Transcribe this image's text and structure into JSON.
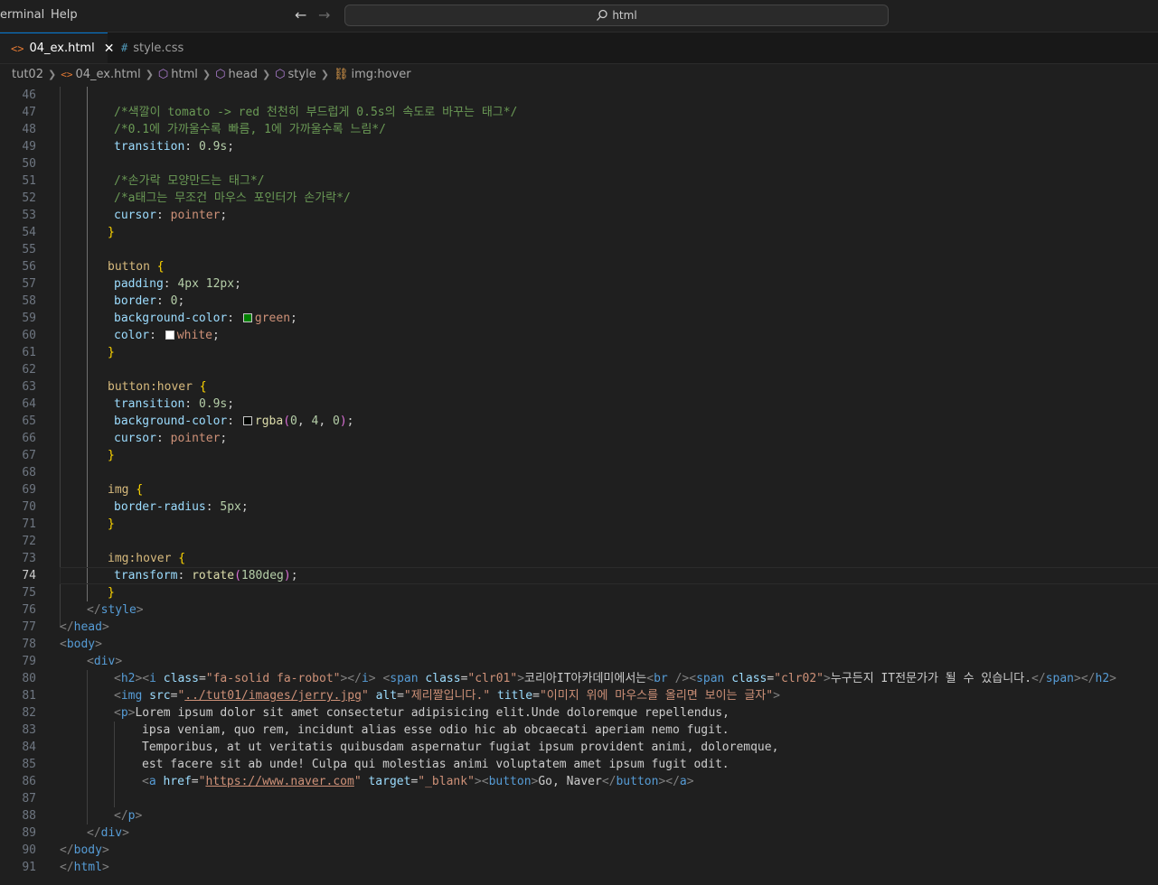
{
  "menu": {
    "terminal": "erminal",
    "help": "Help"
  },
  "search": {
    "text": "html"
  },
  "tabs": [
    {
      "icon": "<>",
      "label": "04_ex.html",
      "close": "✕"
    },
    {
      "icon": "#",
      "label": "style.css"
    }
  ],
  "breadcrumb": [
    "tut02",
    "04_ex.html",
    "html",
    "head",
    "style",
    "img:hover"
  ],
  "colors": {
    "green_swatch": "#008000",
    "white_swatch": "#ffffff",
    "rgba_swatch": "#000400"
  },
  "code": {
    "l46": "46",
    "l47n": "47",
    "l47": "/*색깔이 tomato -> red 천천히 부드럽게 0.5s의 속도로 바꾸는 태그*/",
    "l48n": "48",
    "l48": "/*0.1에 가까울수록 빠름, 1에 가까울수록 느림*/",
    "l49n": "49",
    "l49p": "transition",
    "l49v": "0.9s",
    "l50n": "50",
    "l51n": "51",
    "l51": "/*손가락 모양만드는 태그*/",
    "l52n": "52",
    "l52": "/*a태그는 무조건 마우스 포인터가 손가락*/",
    "l53n": "53",
    "l53p": "cursor",
    "l53v": "pointer",
    "l54n": "54",
    "l55n": "55",
    "l56n": "56",
    "l56s": "button",
    "l57n": "57",
    "l57p": "padding",
    "l57v": "4px 12px",
    "l58n": "58",
    "l58p": "border",
    "l58v": "0",
    "l59n": "59",
    "l59p": "background-color",
    "l59v": "green",
    "l60n": "60",
    "l60p": "color",
    "l60v": "white",
    "l61n": "61",
    "l62n": "62",
    "l63n": "63",
    "l63s": "button:hover",
    "l64n": "64",
    "l64p": "transition",
    "l64v": "0.9s",
    "l65n": "65",
    "l65p": "background-color",
    "l65f": "rgba",
    "l65a": "0",
    "l65b": "4",
    "l65c": "0",
    "l66n": "66",
    "l66p": "cursor",
    "l66v": "pointer",
    "l67n": "67",
    "l68n": "68",
    "l69n": "69",
    "l69s": "img",
    "l70n": "70",
    "l70p": "border-radius",
    "l70v": "5px",
    "l71n": "71",
    "l72n": "72",
    "l73n": "73",
    "l73s": "img:hover",
    "l74n": "74",
    "l74p": "transform",
    "l74f": "rotate",
    "l74v": "180deg",
    "l75n": "75",
    "l76n": "76",
    "l76t": "style",
    "l77n": "77",
    "l77t": "head",
    "l78n": "78",
    "l78t": "body",
    "l79n": "79",
    "l79t": "div",
    "l80n": "80",
    "l80_h2": "h2",
    "l80_i": "i",
    "l80_class": "class",
    "l80_cv": "\"fa-solid fa-robot\"",
    "l80_span": "span",
    "l80_cv1": "\"clr01\"",
    "l80_text1": "코리아IT아카데미에서는",
    "l80_br": "br",
    "l80_cv2": "\"clr02\"",
    "l80_text2": "누구든지 IT전문가가 될 수 있습니다.",
    "l81n": "81",
    "l81_img": "img",
    "l81_src": "src",
    "l81_srcv": "../tut01/images/jerry.jpg",
    "l81_alt": "alt",
    "l81_altv": "\"제리짤입니다.\"",
    "l81_title": "title",
    "l81_titlev": "\"이미지 위에 마우스를 올리면 보이는 글자\"",
    "l82n": "82",
    "l82_p": "p",
    "l82_text": "Lorem ipsum dolor sit amet consectetur adipisicing elit.Unde doloremque repellendus,",
    "l83n": "83",
    "l83": "ipsa veniam, quo rem, incidunt alias esse odio hic ab obcaecati aperiam nemo fugit.",
    "l84n": "84",
    "l84": "Temporibus, at ut veritatis quibusdam aspernatur fugiat ipsum provident animi, doloremque,",
    "l85n": "85",
    "l85": "est facere sit ab unde! Culpa qui molestias animi voluptatem amet ipsum fugit odit.",
    "l86n": "86",
    "l86_a": "a",
    "l86_href": "href",
    "l86_hrefv": "https://www.naver.com",
    "l86_target": "target",
    "l86_targetv": "\"_blank\"",
    "l86_button": "button",
    "l86_btext": "Go, Naver",
    "l87n": "87",
    "l88n": "88",
    "l88t": "p",
    "l89n": "89",
    "l89t": "div",
    "l90n": "90",
    "l90t": "body",
    "l91n": "91",
    "l91t": "html"
  }
}
